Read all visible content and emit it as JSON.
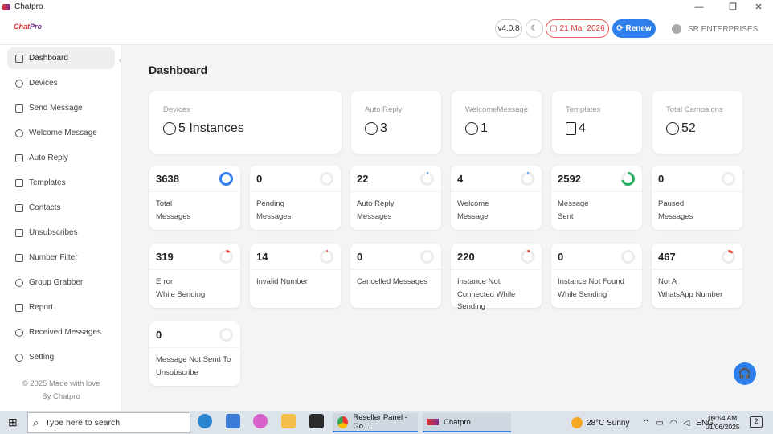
{
  "window": {
    "title": "Chatpro",
    "minimize": "—",
    "restore": "❐",
    "close": "✕"
  },
  "header": {
    "brand_a": "Chat",
    "brand_b": "Pro",
    "version": "v4.0.8",
    "theme_icon": "☾",
    "date": "21 Mar 2026",
    "renew": "Renew",
    "company": "SR ENTERPRISES"
  },
  "sidebar": {
    "items": [
      {
        "label": "Dashboard"
      },
      {
        "label": "Devices"
      },
      {
        "label": "Send Message"
      },
      {
        "label": "Welcome Message"
      },
      {
        "label": "Auto Reply"
      },
      {
        "label": "Templates"
      },
      {
        "label": "Contacts"
      },
      {
        "label": "Unsubscribes"
      },
      {
        "label": "Number Filter"
      },
      {
        "label": "Group Grabber"
      },
      {
        "label": "Report"
      },
      {
        "label": "Received Messages"
      },
      {
        "label": "Setting"
      }
    ],
    "collapse": "‹",
    "footer_line1": "© 2025 Made with love",
    "footer_line2": "By Chatpro"
  },
  "main": {
    "title": "Dashboard",
    "summary": [
      {
        "label": "Devices",
        "value": "5 Instances"
      },
      {
        "label": "Auto Reply",
        "value": "3"
      },
      {
        "label": "WelcomeMessage",
        "value": "1"
      },
      {
        "label": "Templates",
        "value": "4"
      },
      {
        "label": "Total Campaigns",
        "value": "52"
      }
    ],
    "stats": [
      {
        "value": "3638",
        "line1": "Total",
        "line2": "Messages",
        "line3": "",
        "ring": 1.0,
        "color": "#2f80ed"
      },
      {
        "value": "0",
        "line1": "Pending",
        "line2": "Messages",
        "line3": "",
        "ring": 0,
        "color": "#2f80ed"
      },
      {
        "value": "22",
        "line1": "Auto Reply",
        "line2": "Messages",
        "line3": "",
        "ring": 0.02,
        "color": "#2f80ed"
      },
      {
        "value": "4",
        "line1": "Welcome",
        "line2": "Message",
        "line3": "",
        "ring": 0.01,
        "color": "#2f80ed"
      },
      {
        "value": "2592",
        "line1": "Message",
        "line2": "Sent",
        "line3": "",
        "ring": 0.71,
        "color": "#27ae60"
      },
      {
        "value": "0",
        "line1": "Paused",
        "line2": "Messages",
        "line3": "",
        "ring": 0,
        "color": "#2f80ed"
      },
      {
        "value": "319",
        "line1": "Error",
        "line2": "While Sending",
        "line3": "",
        "ring": 0.09,
        "color": "#e74c3c"
      },
      {
        "value": "14",
        "line1": "Invalid Number",
        "line2": "",
        "line3": "",
        "ring": 0.01,
        "color": "#e74c3c"
      },
      {
        "value": "0",
        "line1": "Cancelled Messages",
        "line2": "",
        "line3": "",
        "ring": 0,
        "color": "#e74c3c"
      },
      {
        "value": "220",
        "line1": "Instance Not",
        "line2": "Connected While",
        "line3": "Sending",
        "ring": 0.06,
        "color": "#e74c3c"
      },
      {
        "value": "0",
        "line1": "Instance Not Found",
        "line2": "While Sending",
        "line3": "",
        "ring": 0,
        "color": "#e74c3c"
      },
      {
        "value": "467",
        "line1": "Not A",
        "line2": "WhatsApp Number",
        "line3": "",
        "ring": 0.13,
        "color": "#e74c3c"
      },
      {
        "value": "0",
        "line1": "Message Not Send To",
        "line2": "Unsubscribe",
        "line3": "",
        "ring": 0,
        "color": "#e74c3c"
      }
    ],
    "support_icon": "🎧"
  },
  "taskbar": {
    "start_icon": "⊞",
    "search_icon": "⌕",
    "search_placeholder": "Type here to search",
    "task1": "Reseller Panel - Go...",
    "task2": "Chatpro",
    "weather": "28°C  Sunny",
    "lang": "ENG",
    "time": "09:54 AM",
    "date": "01/06/2025",
    "notif": "2"
  }
}
